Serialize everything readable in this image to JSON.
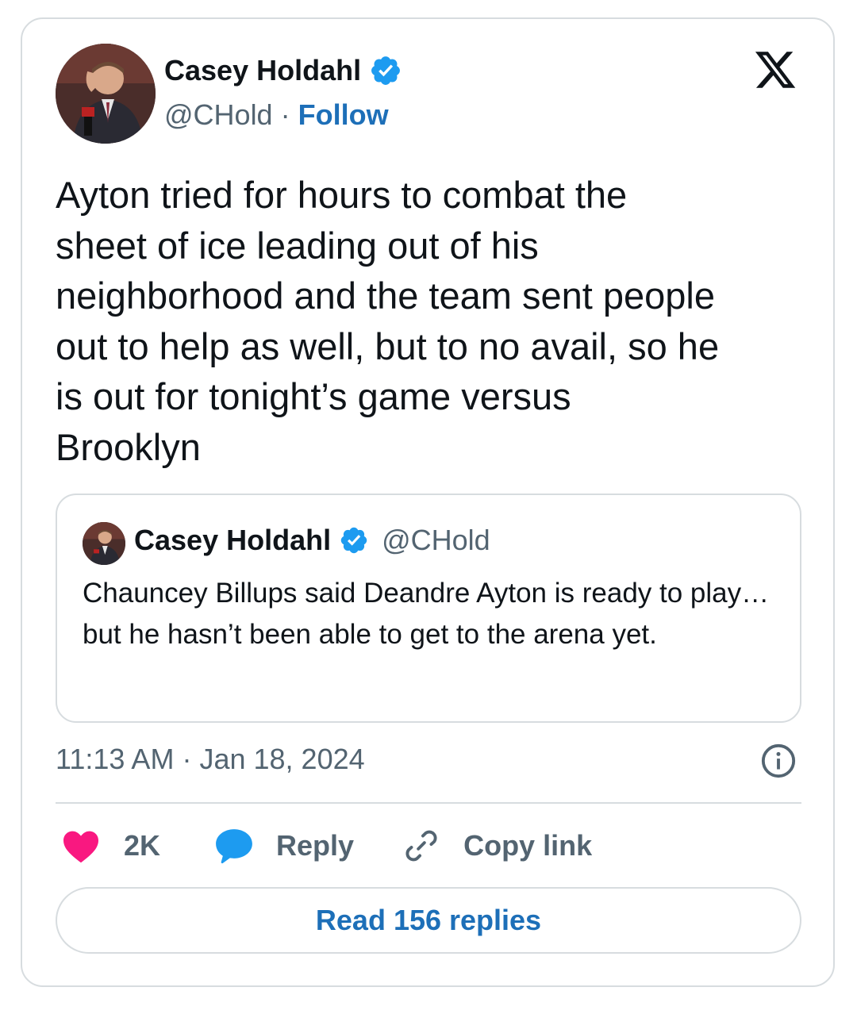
{
  "author": {
    "name": "Casey Holdahl",
    "handle": "@CHold",
    "separator": "·",
    "follow_label": "Follow",
    "verified": true
  },
  "tweet": {
    "text": "Ayton tried for hours to combat the\nsheet of ice leading out of his\nneighborhood and the team sent people\nout to help as well, but to no avail, so he\nis out for tonight’s game versus\nBrooklyn",
    "time": "11:13 AM",
    "date_separator": "·",
    "date": "Jan 18, 2024"
  },
  "quoted_tweet": {
    "name": "Casey Holdahl",
    "handle": "@CHold",
    "text": "Chauncey Billups said Deandre Ayton is ready to play… but he hasn’t been able to get to the arena yet."
  },
  "actions": {
    "like_count": "2K",
    "reply_label": "Reply",
    "copy_link_label": "Copy link"
  },
  "read_replies_label": "Read 156 replies",
  "icons": {
    "verified": "verified-badge-icon",
    "x_logo": "x-logo-icon",
    "info": "info-icon",
    "like": "heart-icon",
    "reply": "speech-bubble-icon",
    "copy": "link-icon"
  },
  "colors": {
    "accent": "#1d6fb8",
    "verified": "#1d9bf0",
    "like": "#f91880",
    "secondary_text": "#536471",
    "border": "#d7dcdf"
  }
}
